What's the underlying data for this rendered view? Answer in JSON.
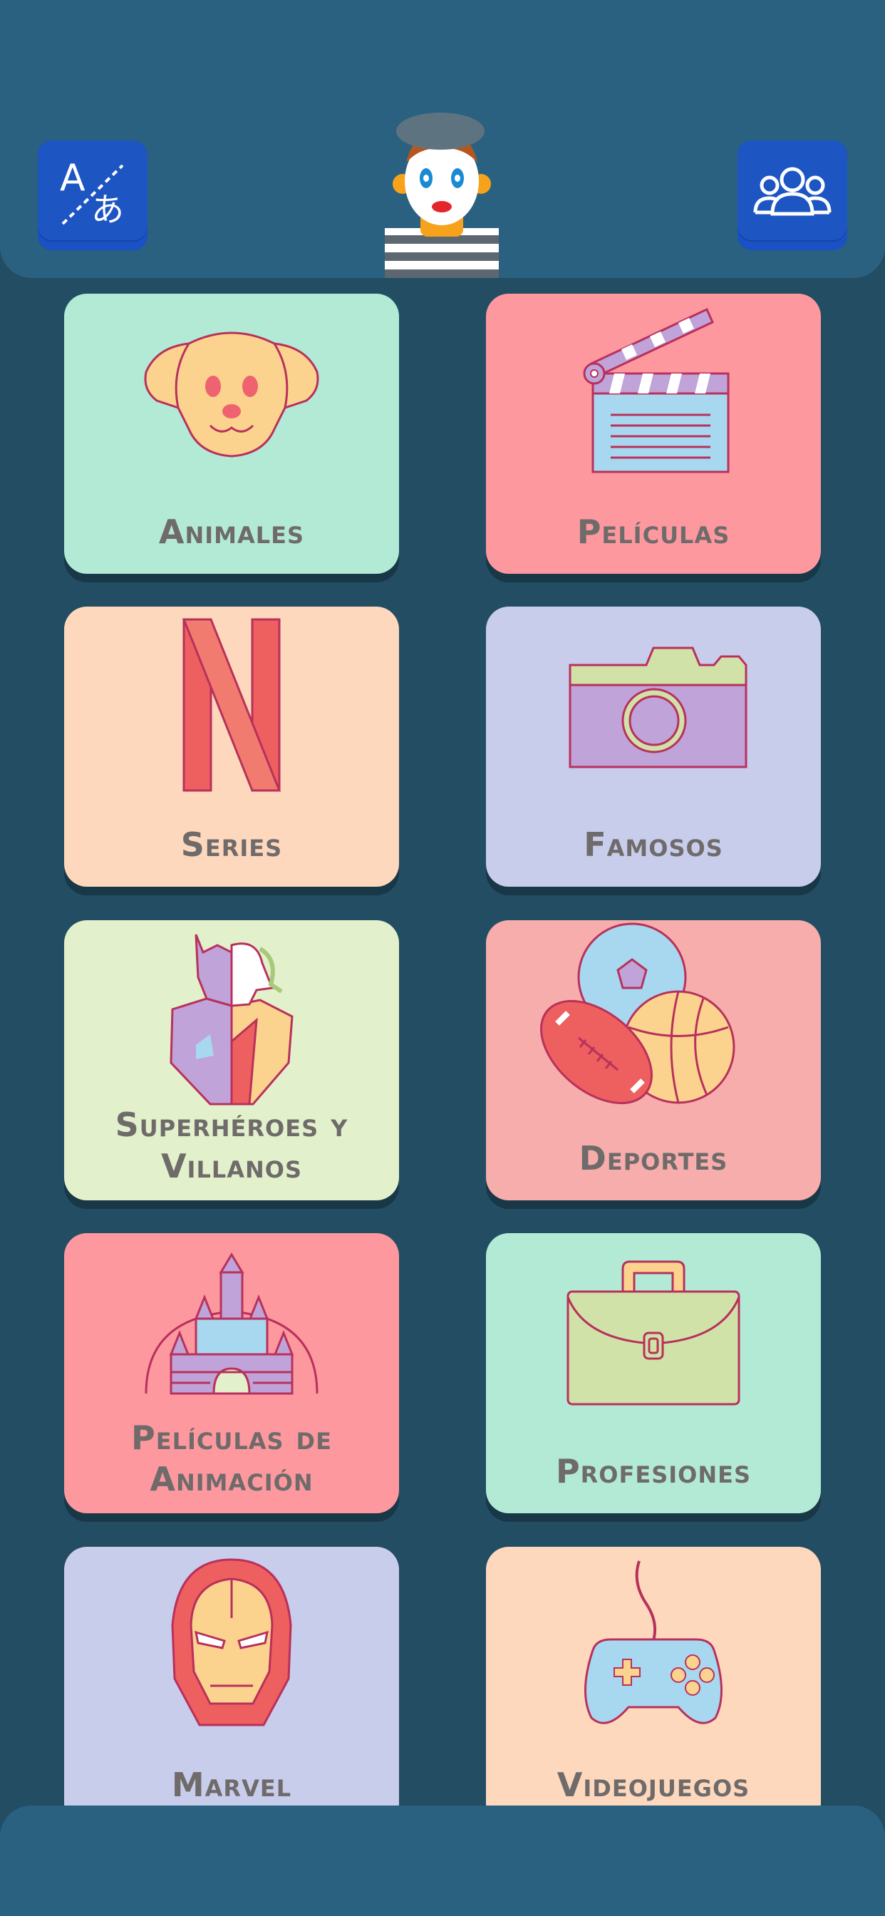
{
  "header": {
    "translate_icon": "translate-icon",
    "players_icon": "users-group-icon",
    "mascot": "mime-avatar"
  },
  "categories": [
    {
      "label": "Animales",
      "icon": "dog-icon",
      "color": "#b3ead6"
    },
    {
      "label": "Películas",
      "icon": "clapperboard-icon",
      "color": "#fe989f"
    },
    {
      "label": "Series",
      "icon": "netflix-n-icon",
      "color": "#fed8bd"
    },
    {
      "label": "Famosos",
      "icon": "camera-icon",
      "color": "#c8cdec"
    },
    {
      "label": "Superhéroes y Villanos",
      "icon": "hero-villain-icon",
      "color": "#e2f1cb"
    },
    {
      "label": "Deportes",
      "icon": "sports-balls-icon",
      "color": "#f6adab"
    },
    {
      "label": "Películas de Animación",
      "icon": "castle-icon",
      "color": "#fe989f"
    },
    {
      "label": "Profesiones",
      "icon": "briefcase-icon",
      "color": "#b3ead6"
    },
    {
      "label": "Marvel",
      "icon": "iron-man-icon",
      "color": "#c8cdec"
    },
    {
      "label": "Videojuegos",
      "icon": "gamepad-icon",
      "color": "#fed8bd"
    }
  ]
}
